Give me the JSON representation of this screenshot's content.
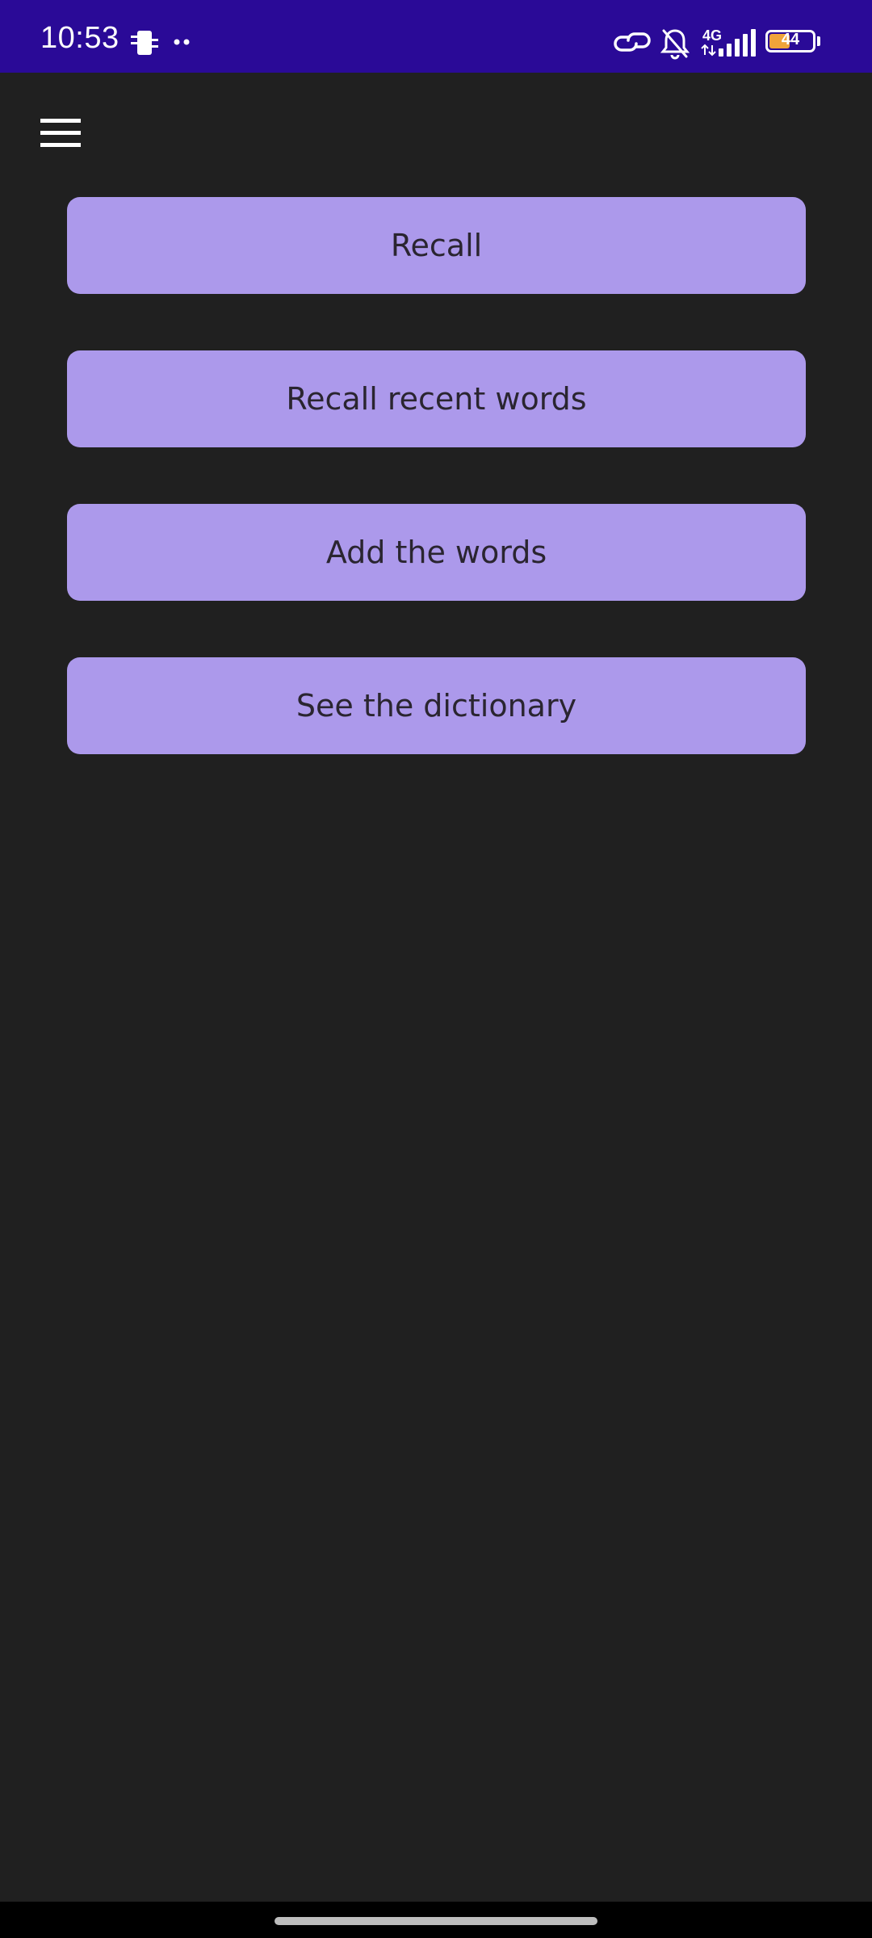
{
  "status_bar": {
    "time": "10:53",
    "network_type": "4G",
    "battery_level": "44",
    "background_color": "#2a0a97",
    "icons": [
      "phone-transfer-icon",
      "more-dots-icon",
      "link-icon",
      "bell-off-icon",
      "signal-icon",
      "battery-icon"
    ]
  },
  "toolbar": {
    "menu_icon": "hamburger-menu-icon"
  },
  "menu": {
    "buttons": [
      {
        "label": "Recall"
      },
      {
        "label": "Recall recent words"
      },
      {
        "label": "Add the words"
      },
      {
        "label": "See the dictionary"
      }
    ]
  },
  "colors": {
    "background": "#202020",
    "button": "#ac99eb",
    "button_text": "#2a2530"
  }
}
